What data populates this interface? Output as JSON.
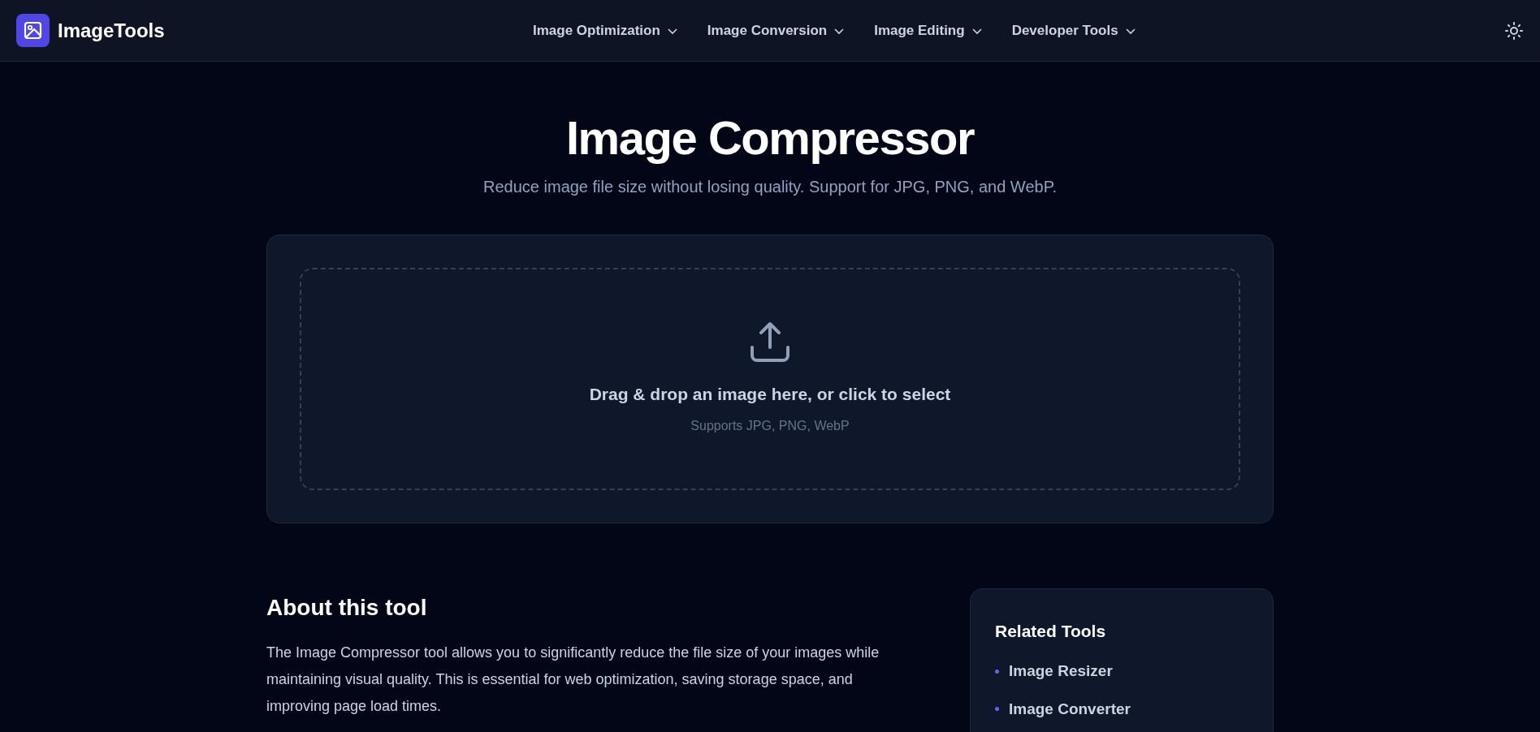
{
  "header": {
    "brand": "ImageTools",
    "nav": [
      {
        "label": "Image Optimization"
      },
      {
        "label": "Image Conversion"
      },
      {
        "label": "Image Editing"
      },
      {
        "label": "Developer Tools"
      }
    ]
  },
  "hero": {
    "title": "Image Compressor",
    "subtitle": "Reduce image file size without losing quality. Support for JPG, PNG, and WebP."
  },
  "dropzone": {
    "prompt": "Drag & drop an image here, or click to select",
    "hint": "Supports JPG, PNG, WebP"
  },
  "about": {
    "heading": "About this tool",
    "paragraph": "The Image Compressor tool allows you to significantly reduce the file size of your images while maintaining visual quality. This is essential for web optimization, saving storage space, and improving page load times."
  },
  "related": {
    "heading": "Related Tools",
    "items": [
      "Image Resizer",
      "Image Converter"
    ]
  }
}
